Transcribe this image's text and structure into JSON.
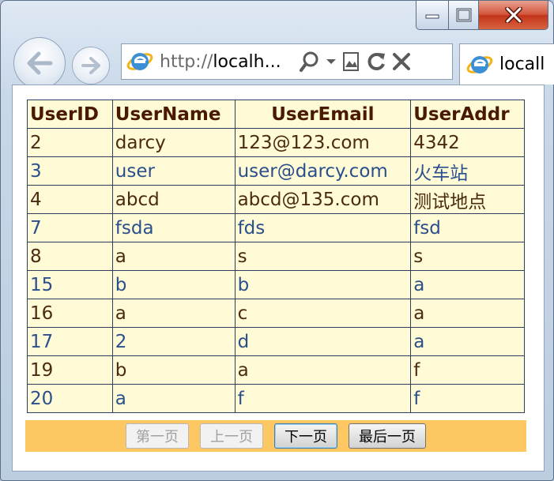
{
  "browser": {
    "address_scheme": "http://",
    "address_host": "localh...",
    "tab_title": "locall"
  },
  "table": {
    "headers": [
      "UserID",
      "UserName",
      "UserEmail",
      "UserAddr"
    ],
    "rows": [
      [
        "2",
        "darcy",
        "123@123.com",
        "4342"
      ],
      [
        "3",
        "user",
        "user@darcy.com",
        "火车站"
      ],
      [
        "4",
        "abcd",
        "abcd@135.com",
        "测试地点"
      ],
      [
        "7",
        "fsda",
        "fds",
        "fsd"
      ],
      [
        "8",
        "a",
        "s",
        "s"
      ],
      [
        "15",
        "b",
        "b",
        "a"
      ],
      [
        "16",
        "a",
        "c",
        "a"
      ],
      [
        "17",
        "2",
        "d",
        "a"
      ],
      [
        "19",
        "b",
        "a",
        "f"
      ],
      [
        "20",
        "a",
        "f",
        "f"
      ]
    ]
  },
  "pager": {
    "first": "第一页",
    "prev": "上一页",
    "next": "下一页",
    "last": "最后一页"
  },
  "colors": {
    "table_bg": "#fffbd6",
    "pager_bg": "#fdc862",
    "close_red": "#c2331a"
  }
}
